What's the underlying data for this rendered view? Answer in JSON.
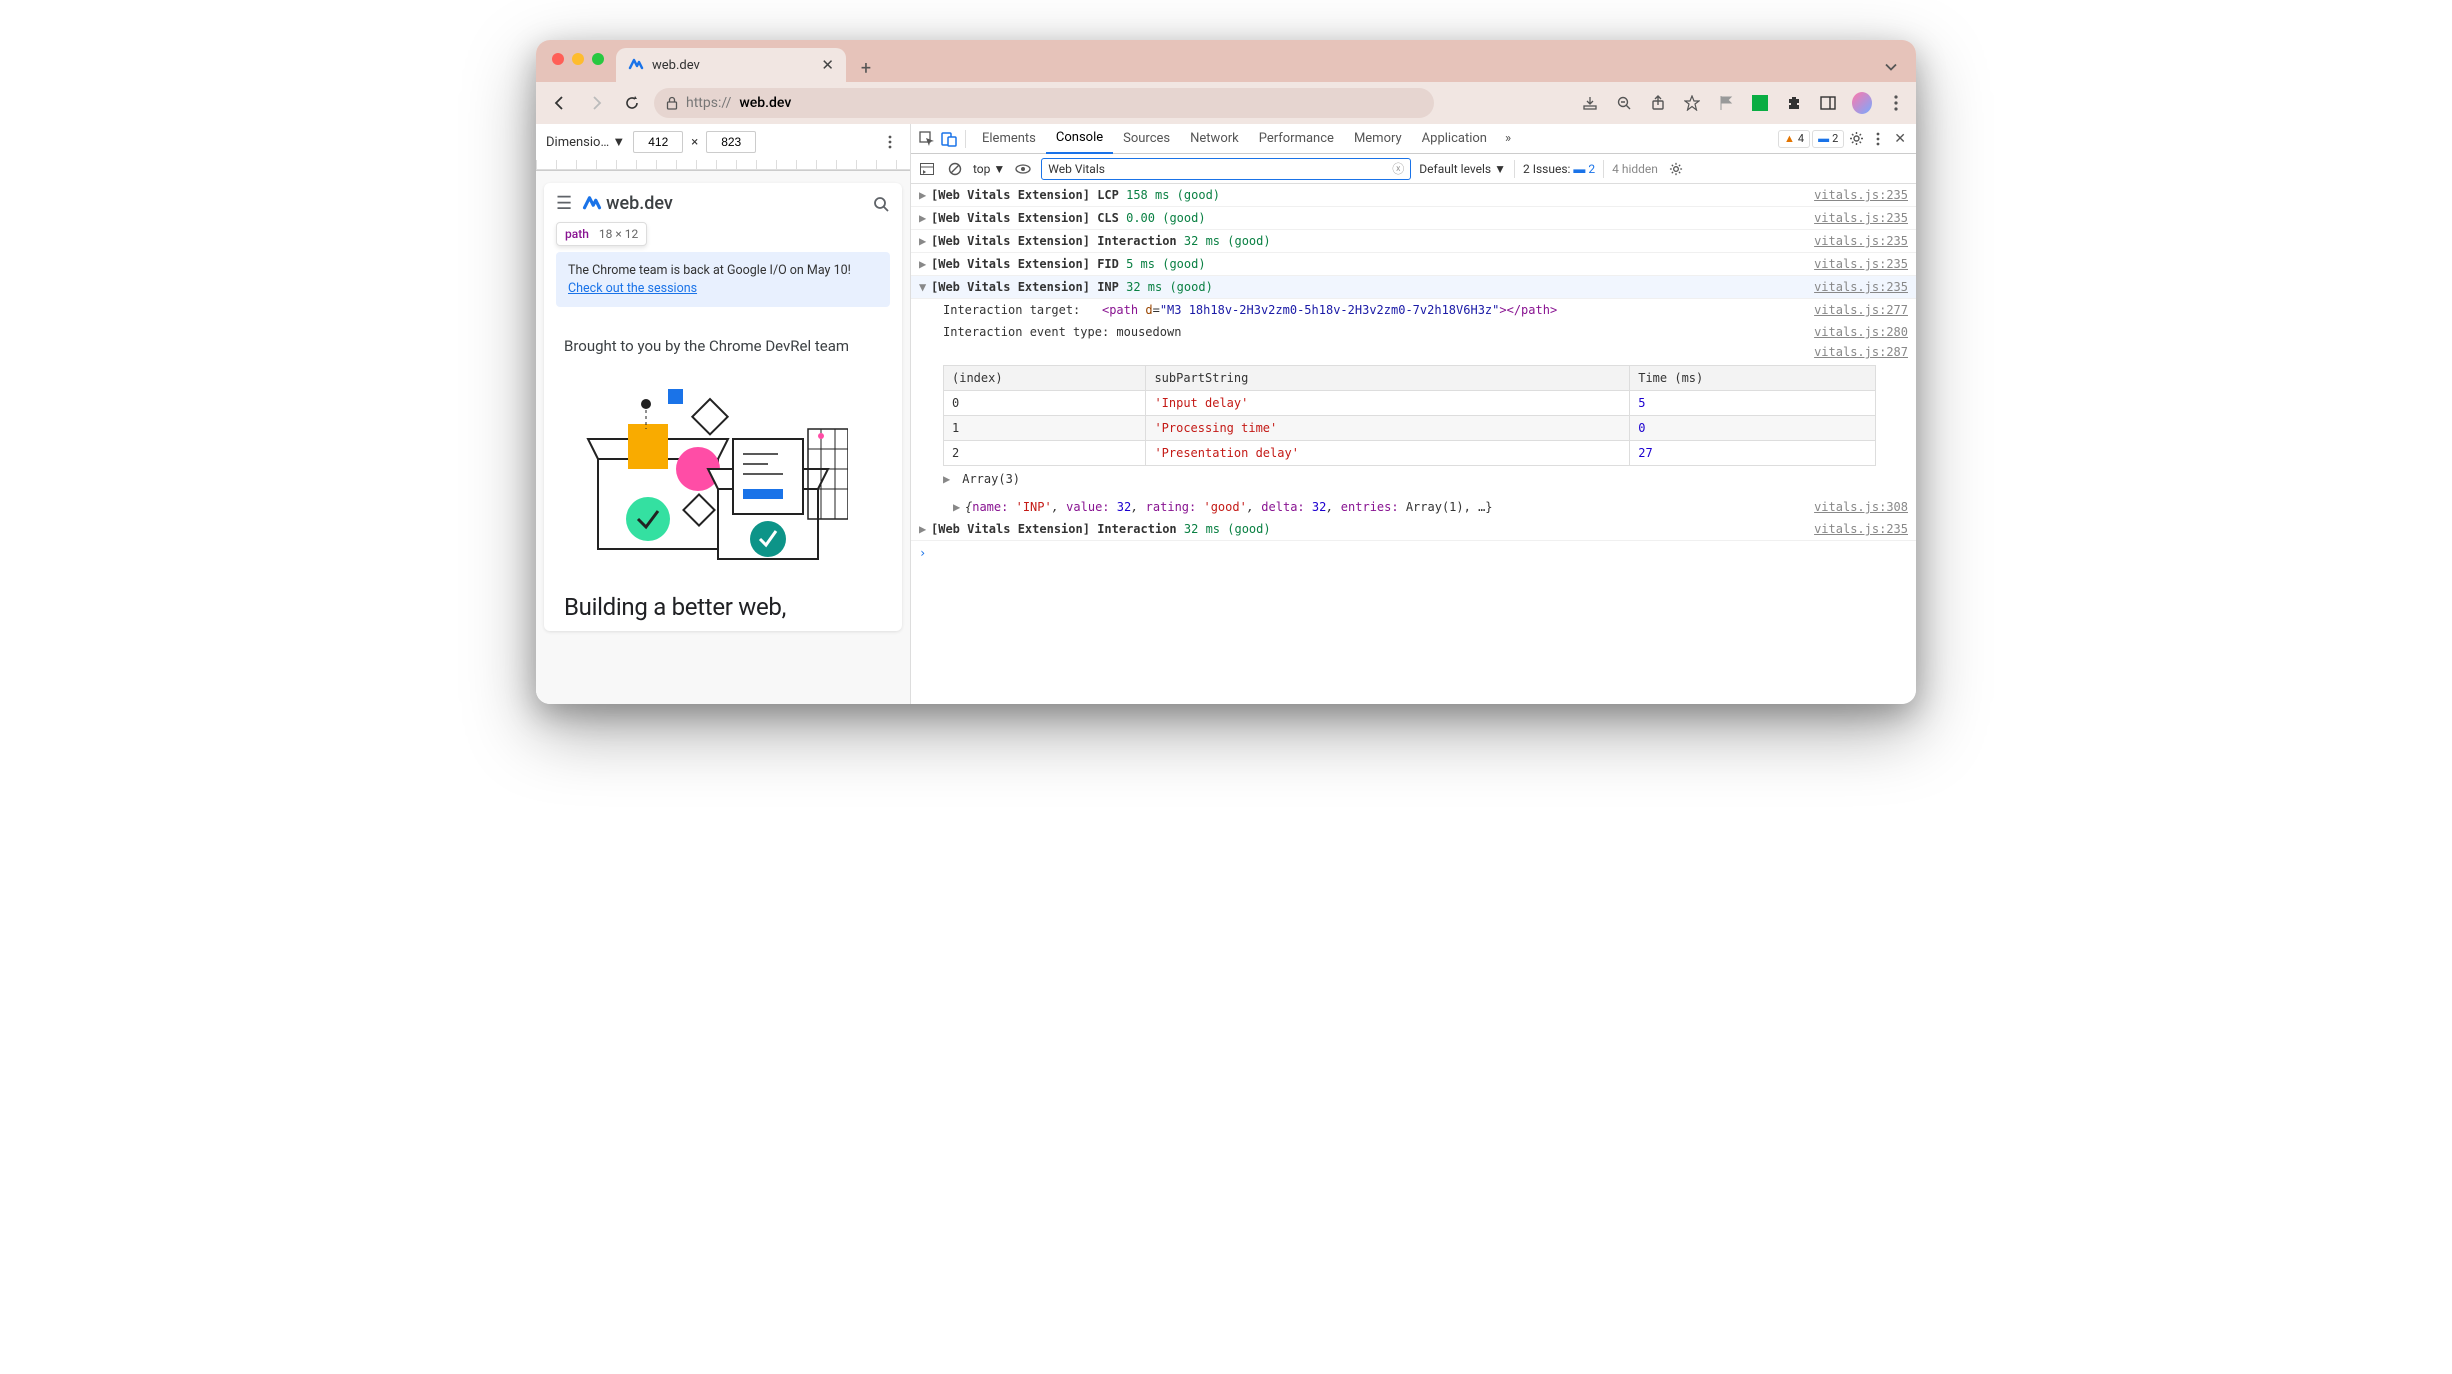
{
  "browser": {
    "tab_title": "web.dev",
    "url_prefix": "https://",
    "url_host": "web.dev"
  },
  "device_toolbar": {
    "label": "Dimensio…",
    "width": "412",
    "height": "823"
  },
  "page": {
    "logo_text": "web.dev",
    "inspect_tag": "path",
    "inspect_dims": "18 × 12",
    "banner_text": "The Chrome team is back at Google I/O on May 10! ",
    "banner_link": "Check out the sessions",
    "brought": "Brought to you by the Chrome DevRel team",
    "hero": "Building a better web,"
  },
  "devtools": {
    "tabs": [
      "Elements",
      "Console",
      "Sources",
      "Network",
      "Performance",
      "Memory",
      "Application"
    ],
    "active_tab": "Console",
    "warning_count": "4",
    "info_count": "2",
    "context": "top",
    "filter_value": "Web Vitals",
    "levels_label": "Default levels",
    "issues_label": "2 Issues:",
    "issues_count": "2",
    "hidden_label": "4 hidden"
  },
  "logs": [
    {
      "prefix": "[Web Vitals Extension]",
      "metric": "LCP",
      "value": "158 ms (good)",
      "src": "vitals.js:235"
    },
    {
      "prefix": "[Web Vitals Extension]",
      "metric": "CLS",
      "value": "0.00 (good)",
      "src": "vitals.js:235"
    },
    {
      "prefix": "[Web Vitals Extension]",
      "metric": "Interaction",
      "value": "32 ms (good)",
      "src": "vitals.js:235"
    },
    {
      "prefix": "[Web Vitals Extension]",
      "metric": "FID",
      "value": "5 ms (good)",
      "src": "vitals.js:235"
    }
  ],
  "expanded_log": {
    "prefix": "[Web Vitals Extension]",
    "metric": "INP",
    "value": "32 ms (good)",
    "src": "vitals.js:235",
    "target_label": "Interaction target:",
    "target_tag": "path",
    "target_attr": "d",
    "target_attr_val": "\"M3 18h18v-2H3v2zm0-5h18v-2H3v2zm0-7v2h18V6H3z\"",
    "target_src": "vitals.js:277",
    "event_label": "Interaction event type:",
    "event_value": "mousedown",
    "event_src": "vitals.js:280",
    "table_src": "vitals.js:287",
    "table_headers": [
      "(index)",
      "subPartString",
      "Time (ms)"
    ],
    "table_rows": [
      {
        "idx": "0",
        "part": "'Input delay'",
        "time": "5"
      },
      {
        "idx": "1",
        "part": "'Processing time'",
        "time": "0"
      },
      {
        "idx": "2",
        "part": "'Presentation delay'",
        "time": "27"
      }
    ],
    "array_label": "Array(3)",
    "obj_src": "vitals.js:308",
    "obj_preview": {
      "name_k": "name:",
      "name_v": "'INP'",
      "value_k": "value:",
      "value_v": "32",
      "rating_k": "rating:",
      "rating_v": "'good'",
      "delta_k": "delta:",
      "delta_v": "32",
      "entries_k": "entries:",
      "entries_v": "Array(1)",
      "rest": ", …}"
    }
  },
  "trailing_log": {
    "prefix": "[Web Vitals Extension]",
    "metric": "Interaction",
    "value": "32 ms (good)",
    "src": "vitals.js:235"
  },
  "chart_data": {
    "type": "table",
    "title": "INP sub-parts",
    "columns": [
      "index",
      "subPartString",
      "Time (ms)"
    ],
    "rows": [
      [
        0,
        "Input delay",
        5
      ],
      [
        1,
        "Processing time",
        0
      ],
      [
        2,
        "Presentation delay",
        27
      ]
    ]
  }
}
